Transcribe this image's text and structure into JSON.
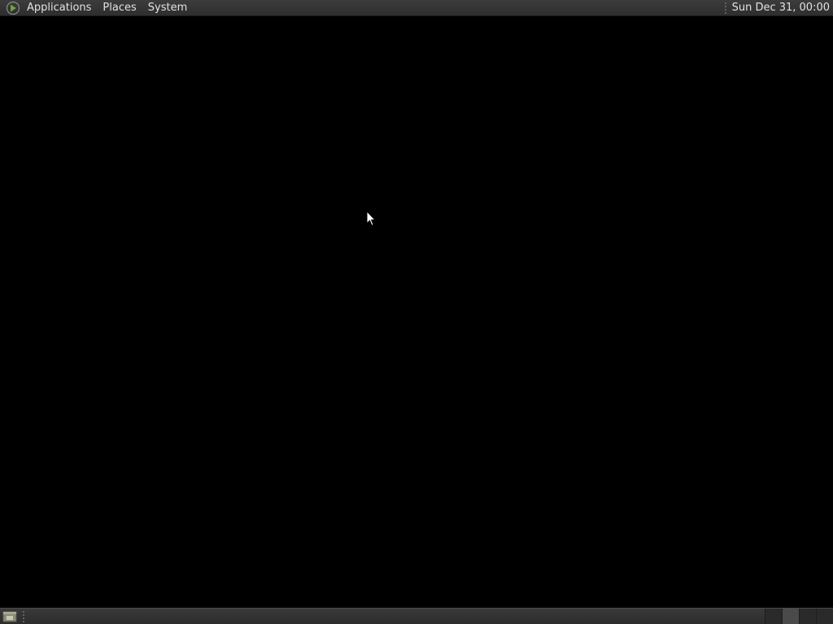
{
  "top_panel": {
    "logo_icon": "main-menu-icon",
    "menus": [
      {
        "label": "Applications"
      },
      {
        "label": "Places"
      },
      {
        "label": "System"
      }
    ],
    "clock": "Sun Dec 31, 00:00"
  },
  "bottom_panel": {
    "show_desktop_icon": "show-desktop-icon",
    "workspaces_count": 4,
    "active_workspace": 1
  },
  "colors": {
    "panel": "#333333",
    "desktop": "#000000",
    "text": "#e2e2e2",
    "logo_accent": "#6fa33a"
  }
}
